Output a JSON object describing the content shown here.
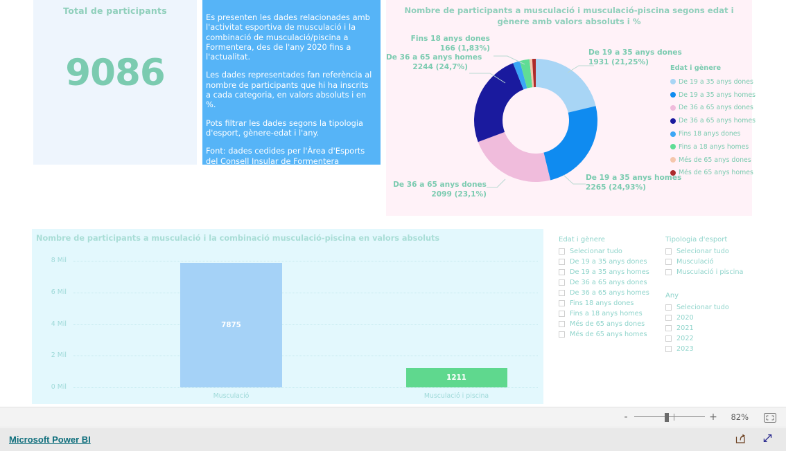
{
  "kpi": {
    "title": "Total de participants",
    "value": "9086"
  },
  "description": {
    "paragraphs": [
      "Es presenten les dades relacionades amb l'activitat esportiva de musculació i la combinació de musculació/piscina a Formentera, des de l'any 2020 fins a l'actualitat.",
      "Les dades representades fan referència al nombre de participants que hi ha inscrits a cada categoria, en valors absoluts i en %.",
      "Pots filtrar les dades segons la tipologia d'esport, gènere-edat i l'any.",
      "Font: dades cedides per l'Àrea d'Esports del Consell Insular de Formentera"
    ]
  },
  "chart_data": [
    {
      "type": "pie",
      "title": "Nombre de participants a musculació i musculació-piscina segons edat i gènere amb valors absoluts i %",
      "legend_title": "Edat i gènere",
      "legend_position": "right",
      "total": 9086,
      "labels": [
        "De 19 a 35 anys dones",
        "De 19 a 35 anys homes",
        "De 36 a 65 anys dones",
        "De 36 a 65 anys homes",
        "Fins 18 anys dones",
        "Fins a 18 anys homes",
        "Més de 65 anys dones",
        "Més de 65 anys homes"
      ],
      "values": [
        1931,
        2265,
        2099,
        2244,
        166,
        232,
        65,
        84
      ],
      "percents": [
        "21,25%",
        "24,93%",
        "23,1%",
        "24,7%",
        "1,83%",
        "2,55%",
        "0,72%",
        "0,92%"
      ],
      "colors": [
        "#a8d5f5",
        "#0f8bf0",
        "#f0bcdc",
        "#1a1a9e",
        "#3ba6f5",
        "#5fdd95",
        "#f5c7ac",
        "#ac2b2b"
      ],
      "data_labels": [
        {
          "name": "De 19 a 35 anys dones",
          "value_line": "1931 (21,25%)"
        },
        {
          "name": "De 19 a 35 anys homes",
          "value_line": "2265 (24,93%)"
        },
        {
          "name": "De 36 a 65 anys dones",
          "value_line": "2099 (23,1%)"
        },
        {
          "name": "De 36 a 65 anys homes",
          "value_line": "2244 (24,7%)"
        },
        {
          "name": "Fins 18 anys dones",
          "value_line": "166 (1,83%)"
        }
      ],
      "legend_entries": [
        {
          "label": "De 19 a 35 anys dones",
          "color": "#a8d5f5"
        },
        {
          "label": "De 19 a 35 anys homes",
          "color": "#0f8bf0"
        },
        {
          "label": "De 36 a 65 anys  dones",
          "color": "#f0bcdc"
        },
        {
          "label": "De 36 a 65 anys  homes",
          "color": "#1a1a9e"
        },
        {
          "label": "Fins 18 anys dones",
          "color": "#3ba6f5"
        },
        {
          "label": "Fins a 18 anys homes",
          "color": "#5fdd95"
        },
        {
          "label": "Més de 65 anys dones",
          "color": "#f5c7ac"
        },
        {
          "label": "Més de 65 anys homes",
          "color": "#ac2b2b"
        }
      ]
    },
    {
      "type": "bar",
      "title": "Nombre de participants a musculació i la combinació musculació-piscina en valors absoluts",
      "categories": [
        "Musculació",
        "Musculació i piscina"
      ],
      "values": [
        7875,
        1211
      ],
      "value_labels": [
        "7875",
        "1211"
      ],
      "colors": [
        "#a5d2f7",
        "#5fd88e"
      ],
      "xlabel": "",
      "ylabel": "",
      "ylim": [
        0,
        8000
      ],
      "yticks": [
        "0 Mil",
        "2 Mil",
        "4 Mil",
        "6 Mil",
        "8 Mil"
      ],
      "ytick_values": [
        0,
        2000,
        4000,
        6000,
        8000
      ],
      "grid": true
    }
  ],
  "slicers": [
    {
      "title": "Edat i gènere",
      "items": [
        "Selecionar tudo",
        "De 19 a 35 anys dones",
        "De 19 a 35 anys homes",
        "De 36 a 65 anys dones",
        "De 36 a 65 anys homes",
        "Fins 18 anys dones",
        "Fins a 18 anys homes",
        "Més de 65 anys dones",
        "Més de 65 anys homes"
      ]
    },
    {
      "title": "Tipologia d'esport",
      "items": [
        "Selecionar tudo",
        "Musculació",
        "Musculació i piscina"
      ]
    },
    {
      "title": "Any",
      "items": [
        "Selecionar tudo",
        "2020",
        "2021",
        "2022",
        "2023"
      ]
    }
  ],
  "toolbar": {
    "zoom_out_label": "-",
    "zoom_in_label": "+",
    "zoom_percent": "82%",
    "fit_icon": "fit-to-page-icon"
  },
  "footer": {
    "brand": "Microsoft Power BI",
    "share_icon": "share-icon",
    "fullscreen_icon": "fullscreen-icon"
  }
}
